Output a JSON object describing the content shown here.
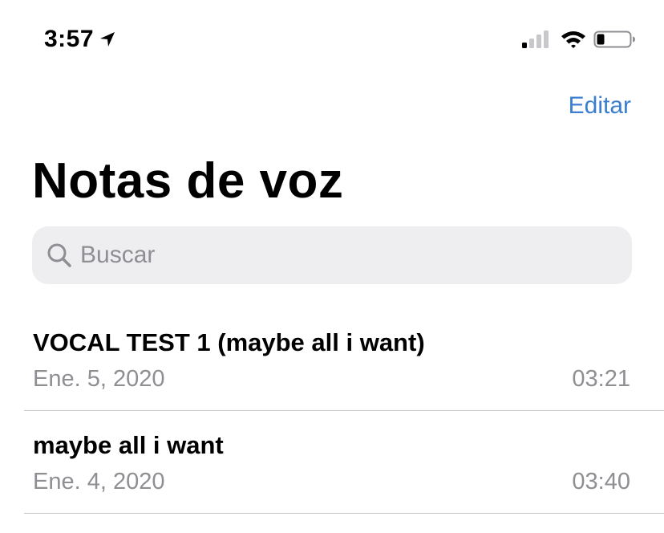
{
  "status_bar": {
    "time": "3:57",
    "location_icon": "location-arrow-icon",
    "signal_icon": "cellular-signal-icon",
    "wifi_icon": "wifi-icon",
    "battery_icon": "battery-low-icon"
  },
  "nav": {
    "edit_label": "Editar"
  },
  "header": {
    "title": "Notas de voz"
  },
  "search": {
    "placeholder": "Buscar",
    "icon": "search-icon"
  },
  "recordings": [
    {
      "title": "VOCAL TEST 1 (maybe all i want)",
      "date": "Ene. 5, 2020",
      "duration": "03:21"
    },
    {
      "title": "maybe all i want",
      "date": "Ene. 4, 2020",
      "duration": "03:40"
    }
  ],
  "colors": {
    "accent": "#3a7ecf",
    "secondary_text": "#8e8e93",
    "search_background": "#eeeef0",
    "divider": "#c8c7cc"
  }
}
